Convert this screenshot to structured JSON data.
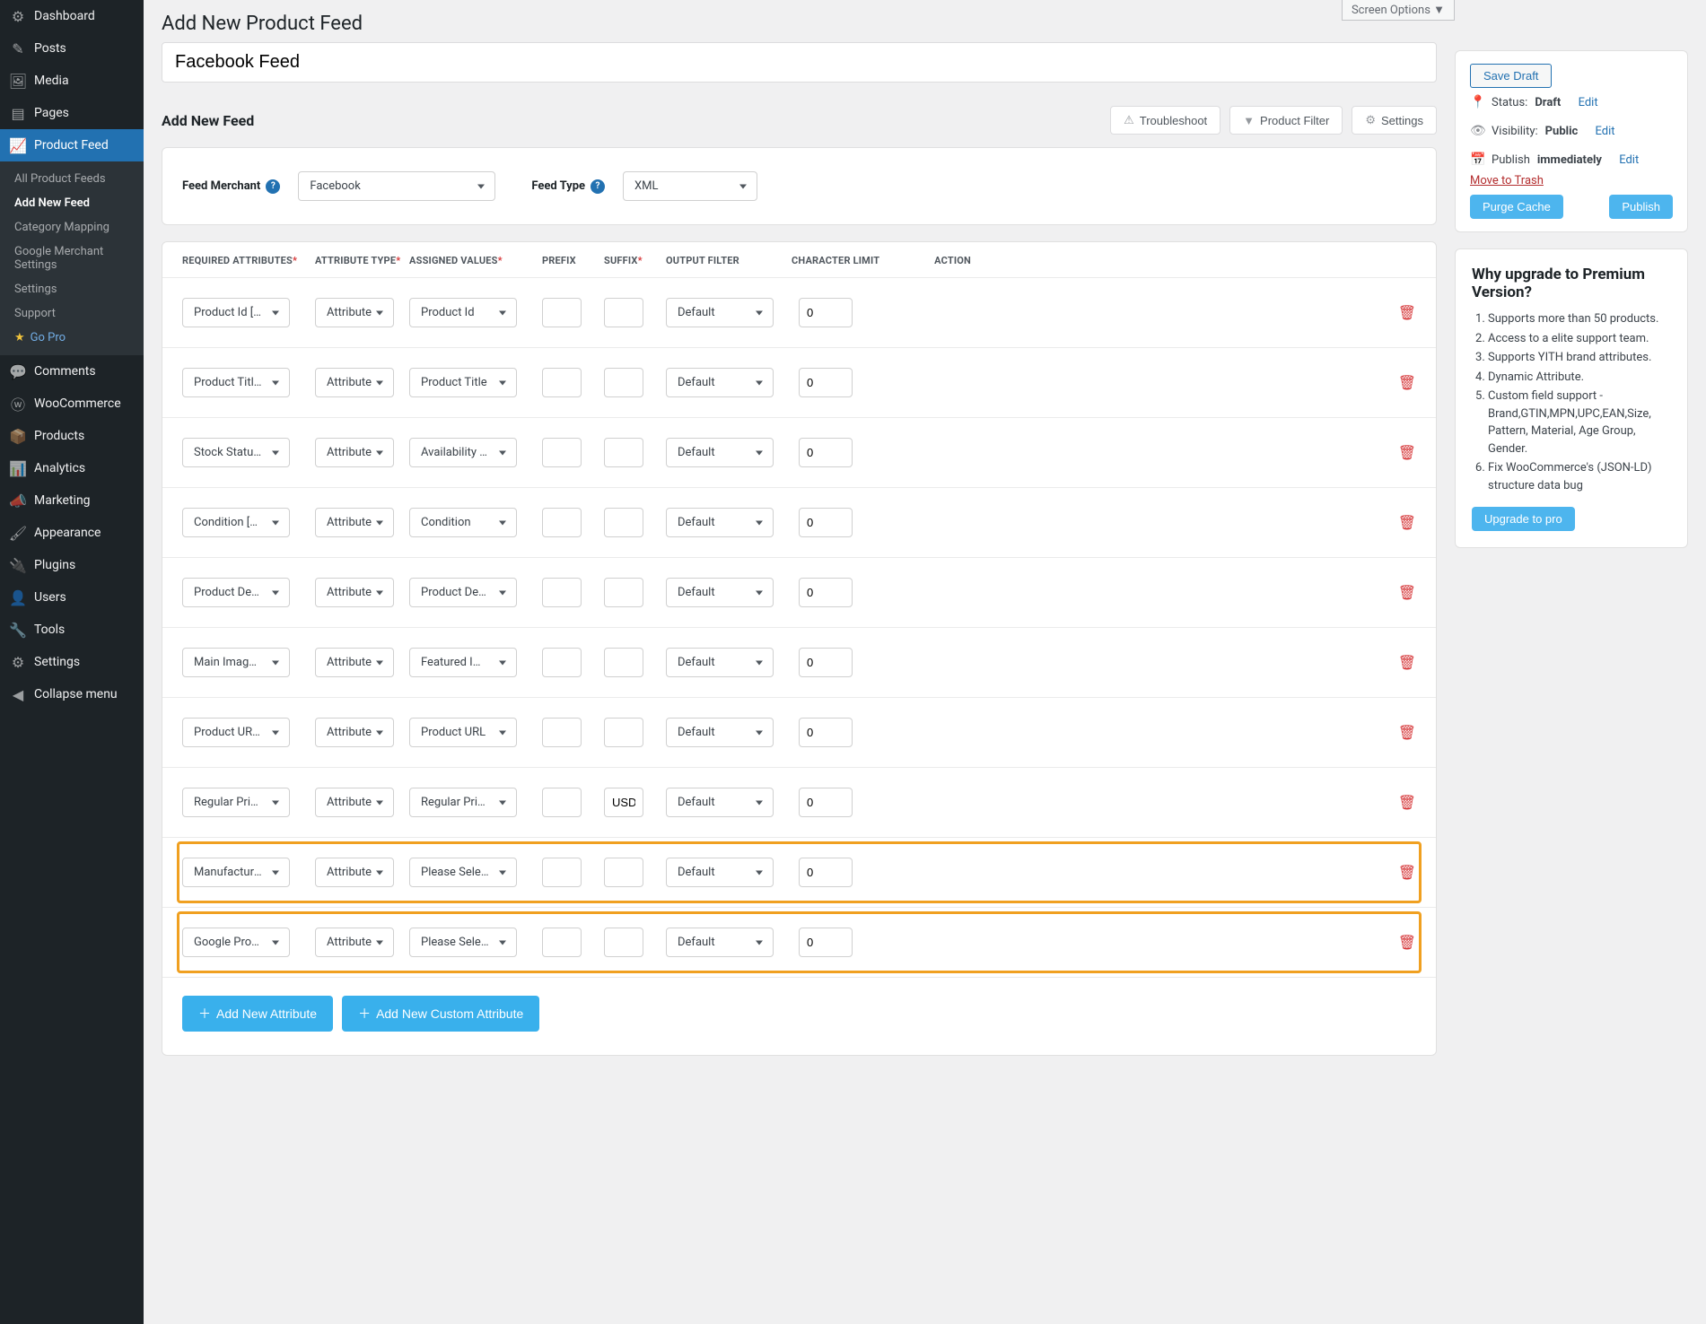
{
  "screen_options": "Screen Options ▼",
  "sidebar": {
    "items": [
      {
        "label": "Dashboard",
        "icon": "⚙"
      },
      {
        "label": "Posts",
        "icon": "✎"
      },
      {
        "label": "Media",
        "icon": "🖼"
      },
      {
        "label": "Pages",
        "icon": "▤"
      },
      {
        "label": "Product Feed",
        "icon": "📈",
        "active": true
      },
      {
        "label": "Comments",
        "icon": "💬"
      },
      {
        "label": "WooCommerce",
        "icon": "ⓦ"
      },
      {
        "label": "Products",
        "icon": "📦"
      },
      {
        "label": "Analytics",
        "icon": "📊"
      },
      {
        "label": "Marketing",
        "icon": "📣"
      },
      {
        "label": "Appearance",
        "icon": "🖌"
      },
      {
        "label": "Plugins",
        "icon": "🔌"
      },
      {
        "label": "Users",
        "icon": "👤"
      },
      {
        "label": "Tools",
        "icon": "🔧"
      },
      {
        "label": "Settings",
        "icon": "⚙"
      },
      {
        "label": "Collapse menu",
        "icon": "◀"
      }
    ],
    "submenu": [
      {
        "label": "All Product Feeds"
      },
      {
        "label": "Add New Feed",
        "active": true
      },
      {
        "label": "Category Mapping"
      },
      {
        "label": "Google Merchant Settings"
      },
      {
        "label": "Settings"
      },
      {
        "label": "Support"
      },
      {
        "label": "Go Pro",
        "gopro": true
      }
    ]
  },
  "page_title": "Add New Product Feed",
  "feed_title": "Facebook Feed",
  "section_header": "Add New Feed",
  "toolbar": {
    "troubleshoot": "Troubleshoot",
    "product_filter": "Product Filter",
    "settings": "Settings"
  },
  "merchant": {
    "label": "Feed Merchant",
    "value": "Facebook",
    "type_label": "Feed Type",
    "type_value": "XML"
  },
  "table": {
    "headers": {
      "required": "REQUIRED ATTRIBUTES",
      "attr_type": "ATTRIBUTE TYPE",
      "assigned": "ASSIGNED VALUES",
      "prefix": "PREFIX",
      "suffix": "SUFFIX",
      "filter": "OUTPUT FILTER",
      "limit": "CHARACTER LIMIT",
      "action": "ACTION"
    },
    "rows": [
      {
        "req": "Product Id [id]",
        "type": "Attribute",
        "assigned": "Product Id",
        "prefix": "",
        "suffix": "",
        "filter": "Default",
        "limit": "0"
      },
      {
        "req": "Product Title [title]",
        "type": "Attribute",
        "assigned": "Product Title",
        "prefix": "",
        "suffix": "",
        "filter": "Default",
        "limit": "0"
      },
      {
        "req": "Stock Status [availability]",
        "type": "Attribute",
        "assigned": "Availability (Without Underscore)",
        "prefix": "",
        "suffix": "",
        "filter": "Default",
        "limit": "0"
      },
      {
        "req": "Condition [condition]",
        "type": "Attribute",
        "assigned": "Condition",
        "prefix": "",
        "suffix": "",
        "filter": "Default",
        "limit": "0"
      },
      {
        "req": "Product Description [description]",
        "type": "Attribute",
        "assigned": "Product Description",
        "prefix": "",
        "suffix": "",
        "filter": "Default",
        "limit": "0"
      },
      {
        "req": "Main Image [image_link]",
        "type": "Attribute",
        "assigned": "Featured Image",
        "prefix": "",
        "suffix": "",
        "filter": "Default",
        "limit": "0"
      },
      {
        "req": "Product URL [link]",
        "type": "Attribute",
        "assigned": "Product URL",
        "prefix": "",
        "suffix": "",
        "filter": "Default",
        "limit": "0"
      },
      {
        "req": "Regular Price [price]",
        "type": "Attribute",
        "assigned": "Regular Price",
        "prefix": "",
        "suffix": "USD",
        "filter": "Default",
        "limit": "0"
      },
      {
        "req": "Manufacturer [brand]",
        "type": "Attribute",
        "assigned": "Please Select",
        "prefix": "",
        "suffix": "",
        "filter": "Default",
        "limit": "0",
        "highlight": true
      },
      {
        "req": "Google Product Category [google_product_category]",
        "type": "Attribute",
        "assigned": "Please Select",
        "prefix": "",
        "suffix": "",
        "filter": "Default",
        "limit": "0",
        "highlight": true
      }
    ]
  },
  "actions": {
    "add_attr": "Add New Attribute",
    "add_custom": "Add New Custom Attribute"
  },
  "publish": {
    "save_draft": "Save Draft",
    "status_label": "Status:",
    "status_value": "Draft",
    "status_edit": "Edit",
    "visibility_label": "Visibility:",
    "visibility_value": "Public",
    "visibility_edit": "Edit",
    "publish_label": "Publish",
    "publish_value": "immediately",
    "publish_edit": "Edit",
    "trash": "Move to Trash",
    "purge": "Purge Cache",
    "publish_btn": "Publish"
  },
  "upgrade": {
    "title": "Why upgrade to Premium Version?",
    "items": [
      "Supports more than 50 products.",
      "Access to a elite support team.",
      "Supports YITH brand attributes.",
      "Dynamic Attribute.",
      "Custom field support - Brand,GTIN,MPN,UPC,EAN,Size, Pattern, Material, Age Group, Gender.",
      "Fix WooCommerce's (JSON-LD) structure data bug"
    ],
    "btn": "Upgrade to pro"
  }
}
